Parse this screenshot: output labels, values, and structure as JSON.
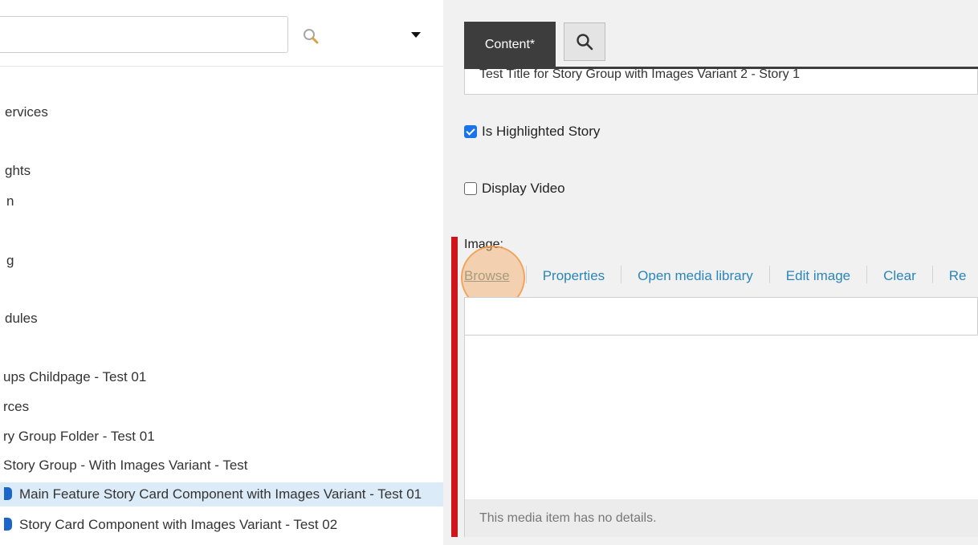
{
  "tree_panel": {
    "search": {
      "value": "",
      "placeholder": ""
    },
    "icons": {
      "search": "search-icon",
      "dropdown": "caret-down-icon"
    },
    "items": [
      {
        "label": "ervices",
        "selected": false
      },
      {
        "label": "ghts",
        "selected": false
      },
      {
        "label": "n",
        "selected": false
      },
      {
        "label": "g",
        "selected": false
      },
      {
        "label": "dules",
        "selected": false
      },
      {
        "label": "ups Childpage - Test 01",
        "selected": false
      },
      {
        "label": "rces",
        "selected": false
      },
      {
        "label": "ry Group Folder - Test 01",
        "selected": false
      },
      {
        "label": "Story Group - With Images Variant - Test",
        "selected": false
      },
      {
        "label": "Main Feature Story Card Component with Images Variant - Test 01",
        "selected": true
      },
      {
        "label": "Story Card Component with Images Variant - Test 02",
        "selected": false
      }
    ]
  },
  "editor": {
    "tabs": {
      "content_label": "Content*",
      "search_icon": "search-icon"
    },
    "title_value": "Test Title for Story Group with Images Variant 2 - Story 1",
    "highlighted": {
      "label": "Is Highlighted Story",
      "checked": true
    },
    "display_video": {
      "label": "Display Video",
      "checked": false
    },
    "image": {
      "label": "Image:",
      "actions": {
        "browse": "Browse",
        "properties": "Properties",
        "open_media_library": "Open media library",
        "edit_image": "Edit image",
        "clear": "Clear",
        "more": "Re"
      },
      "no_details": "This media item has no details."
    },
    "colors": {
      "accent": "#2b86b8",
      "tab_dark": "#3d3d3d",
      "required_bar": "#d0141b",
      "selected_row": "#dcebf8"
    }
  }
}
